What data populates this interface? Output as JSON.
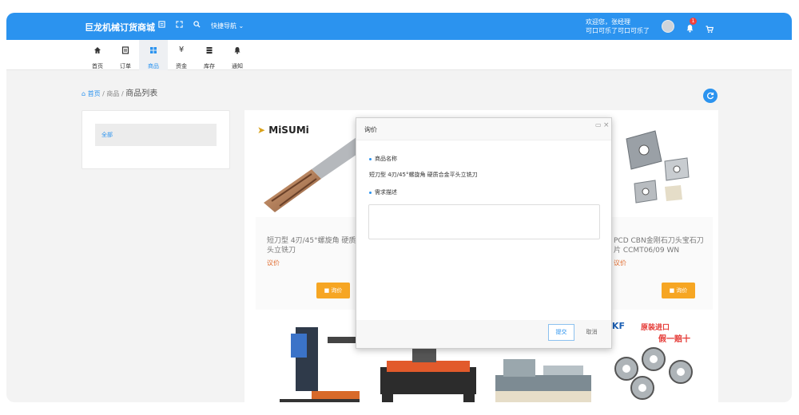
{
  "topbar": {
    "brand": "巨龙机械订货商城",
    "quick_nav": "快捷导航",
    "welcome_line1": "欢迎您，张经理",
    "welcome_line2": "可口可乐了可口可乐了",
    "badge": "1",
    "icons": [
      "list-icon",
      "fullscreen-icon",
      "search-icon",
      "bell-icon",
      "cart-icon"
    ]
  },
  "nav": {
    "items": [
      {
        "label": "首页",
        "icon": "home-icon"
      },
      {
        "label": "订单",
        "icon": "order-icon"
      },
      {
        "label": "商品",
        "icon": "grid-icon",
        "active": true
      },
      {
        "label": "资金",
        "icon": "yen-icon"
      },
      {
        "label": "库存",
        "icon": "stock-icon"
      },
      {
        "label": "通知",
        "icon": "bell-icon"
      }
    ]
  },
  "breadcrumb": {
    "home": "首页",
    "sep": "/",
    "middle": "商品",
    "current": "商品列表"
  },
  "category": {
    "all": "全部"
  },
  "products": [
    {
      "brand_logo": "MiSUMi",
      "name": "短刀型 4刃/45°螺旋角 硬质合金平头立铣刀",
      "price": "议价",
      "button": "询价"
    },
    {
      "name": "PCD CBN金刚石刀头宝石刀片 CCMT06/09 WN",
      "price": "议价",
      "button": "询价"
    }
  ],
  "bottom_banner": {
    "brand": "SKF",
    "text1": "原装进口",
    "text2": "假一赔十"
  },
  "modal": {
    "title": "询价",
    "field1_label": "商品名称",
    "field1_value": "短刀型 4刃/45°螺旋角 硬质合金平头立铣刀",
    "field2_label": "需求描述",
    "textarea_value": "",
    "submit": "提交",
    "cancel": "取消"
  },
  "colors": {
    "primary": "#2b93ef",
    "warning": "#f6a623",
    "price": "#e06a2c"
  }
}
